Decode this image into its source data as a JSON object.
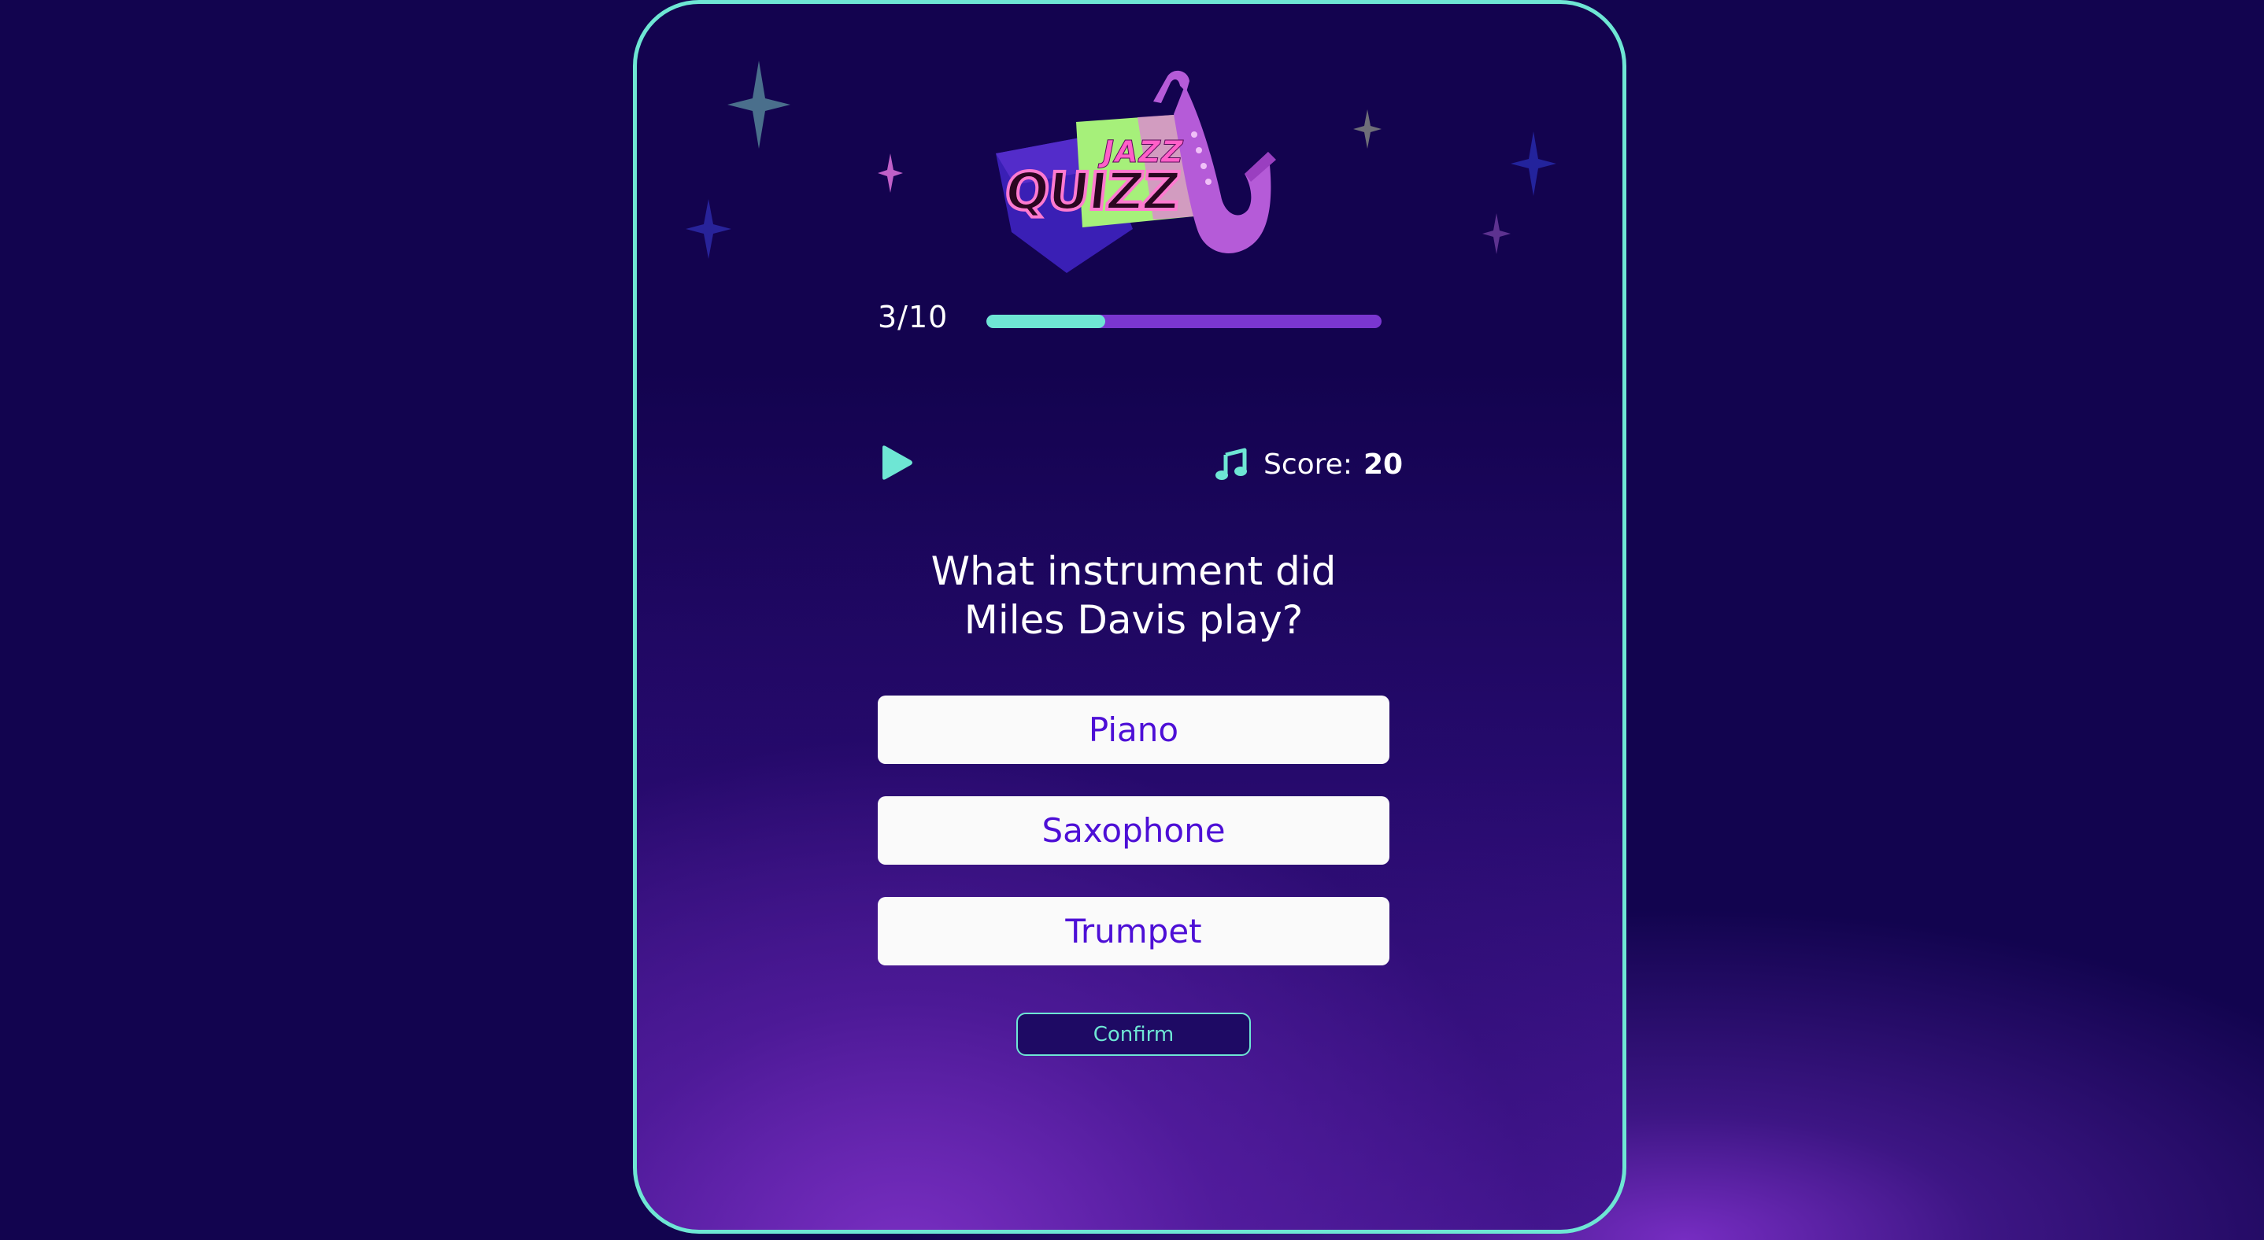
{
  "logo": {
    "line1": "JAZZ",
    "line2": "QUIZZ"
  },
  "progress": {
    "label": "3/10",
    "fraction": 0.3
  },
  "controls": {
    "play_icon": "play-icon",
    "note_icon": "music-note-icon"
  },
  "score": {
    "label": "Score:",
    "value": "20"
  },
  "question": {
    "text": "What instrument did Miles Davis play?"
  },
  "answers": [
    {
      "label": "Piano"
    },
    {
      "label": "Saxophone"
    },
    {
      "label": "Trumpet"
    }
  ],
  "confirm": {
    "label": "Confirm"
  },
  "colors": {
    "accent": "#6ee6d4",
    "background": "#12044f",
    "answer_text": "#4d0fd6",
    "progress_track": "#7a36d0"
  }
}
